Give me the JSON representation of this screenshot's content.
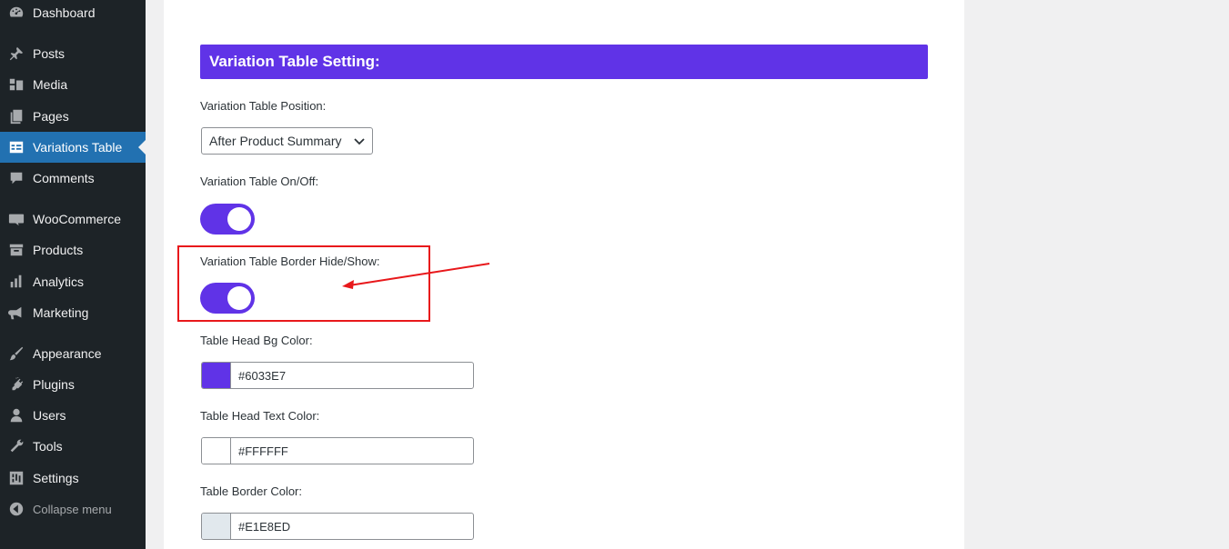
{
  "sidebar": {
    "items": [
      {
        "label": "Dashboard",
        "icon": "dashboard-icon"
      },
      {
        "label": "Posts",
        "icon": "pin-icon"
      },
      {
        "label": "Media",
        "icon": "media-icon"
      },
      {
        "label": "Pages",
        "icon": "pages-icon"
      },
      {
        "label": "Variations Table",
        "icon": "table-icon",
        "active": true
      },
      {
        "label": "Comments",
        "icon": "comment-icon"
      },
      {
        "label": "WooCommerce",
        "icon": "woo-icon"
      },
      {
        "label": "Products",
        "icon": "archive-icon"
      },
      {
        "label": "Analytics",
        "icon": "bar-chart-icon"
      },
      {
        "label": "Marketing",
        "icon": "megaphone-icon"
      },
      {
        "label": "Appearance",
        "icon": "brush-icon"
      },
      {
        "label": "Plugins",
        "icon": "plug-icon"
      },
      {
        "label": "Users",
        "icon": "user-icon"
      },
      {
        "label": "Tools",
        "icon": "wrench-icon"
      },
      {
        "label": "Settings",
        "icon": "sliders-icon"
      },
      {
        "label": "Collapse menu",
        "icon": "collapse-icon"
      }
    ],
    "bg_color": "#1d2327",
    "active_color": "#2271b1"
  },
  "settings": {
    "section_title": "Variation Table Setting:",
    "accent_color": "#6033e7",
    "position_label": "Variation Table Position:",
    "position_value": "After Product Summary",
    "onoff_label": "Variation Table On/Off:",
    "onoff_value": "on",
    "border_label": "Variation Table Border Hide/Show:",
    "border_value": "on",
    "head_bg_label": "Table Head Bg Color:",
    "head_bg_value": "#6033E7",
    "head_text_label": "Table Head Text Color:",
    "head_text_value": "#FFFFFF",
    "border_color_label": "Table Border Color:",
    "border_color_value": "#E1E8ED"
  },
  "annotation": {
    "color": "#e8181b"
  }
}
